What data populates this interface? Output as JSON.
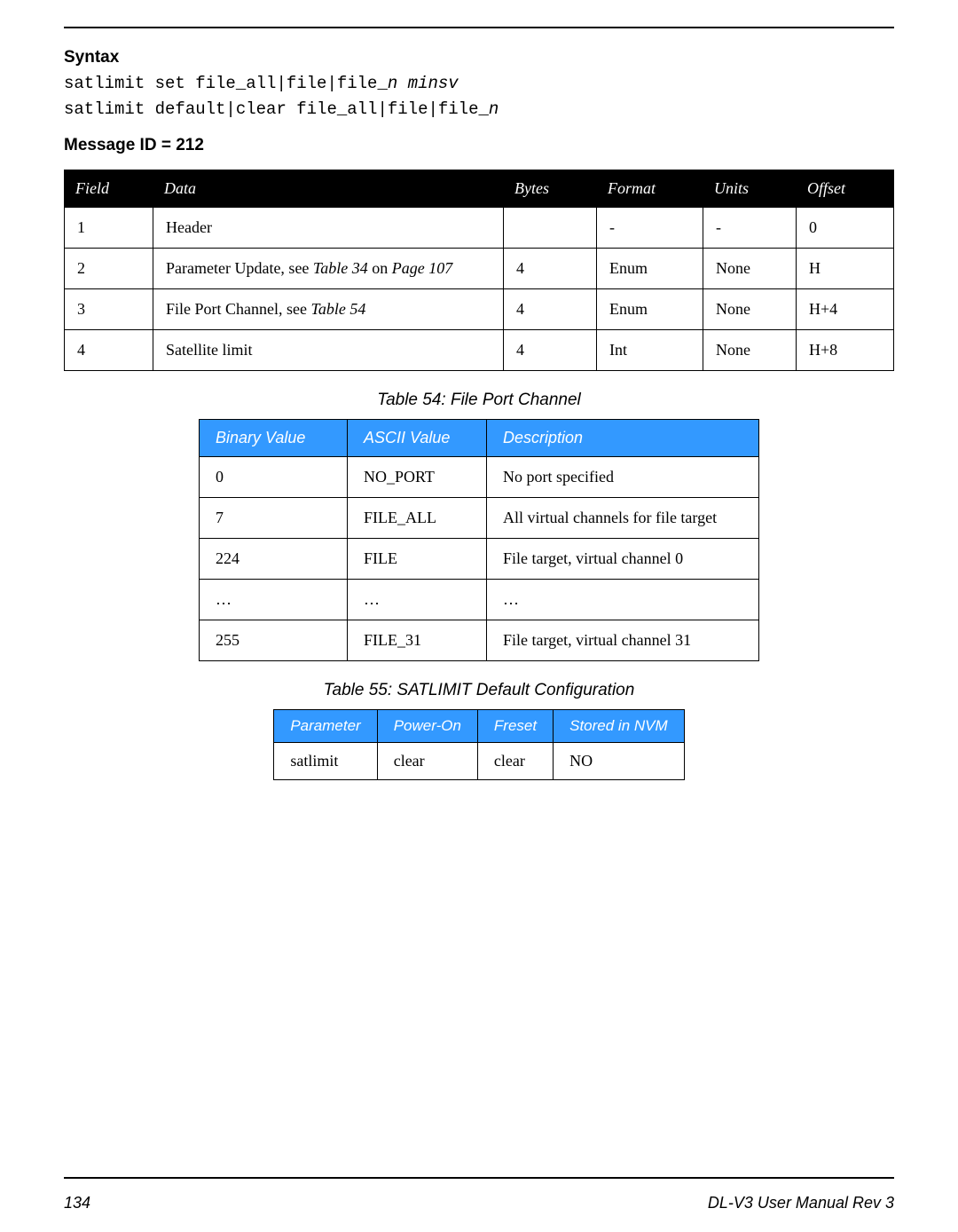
{
  "headings": {
    "syntax": "Syntax",
    "message_id": "Message ID = 212"
  },
  "syntax_lines": {
    "line1_prefix": "satlimit set file_all|file|file_",
    "line1_n": "n",
    "line1_space": " ",
    "line1_minsv": "minsv",
    "line2_prefix": "satlimit default|clear file_all|file|file_",
    "line2_n": "n"
  },
  "table_fields": {
    "headers": {
      "field": "Field",
      "data": "Data",
      "bytes": "Bytes",
      "format": "Format",
      "units": "Units",
      "offset": "Offset"
    },
    "rows": [
      {
        "field": "1",
        "data": "Header",
        "bytes": "",
        "format": "-",
        "units": "-",
        "offset": "0"
      },
      {
        "field": "2",
        "data_prefix": "Parameter Update, see ",
        "data_ref1": "Table 34",
        "data_mid": " on ",
        "data_ref2": "Page 107",
        "bytes": "4",
        "format": "Enum",
        "units": "None",
        "offset": "H"
      },
      {
        "field": "3",
        "data_prefix": "File Port Channel, see ",
        "data_ref1": "Table 54",
        "bytes": "4",
        "format": "Enum",
        "units": "None",
        "offset": "H+4"
      },
      {
        "field": "4",
        "data": "Satellite limit",
        "bytes": "4",
        "format": "Int",
        "units": "None",
        "offset": "H+8"
      }
    ]
  },
  "table54": {
    "caption": "Table 54: File Port Channel",
    "headers": {
      "bin": "Binary Value",
      "ascii": "ASCII Value",
      "desc": "Description"
    },
    "rows": [
      {
        "bin": "0",
        "ascii": "NO_PORT",
        "desc": "No port specified"
      },
      {
        "bin": "7",
        "ascii": "FILE_ALL",
        "desc": "All virtual channels for file target"
      },
      {
        "bin": "224",
        "ascii": "FILE",
        "desc": "File target, virtual channel 0"
      },
      {
        "bin": "…",
        "ascii": "…",
        "desc": "…"
      },
      {
        "bin": "255",
        "ascii": "FILE_31",
        "desc": "File target, virtual channel 31"
      }
    ]
  },
  "table55": {
    "caption": "Table 55: SATLIMIT Default Configuration",
    "headers": {
      "param": "Parameter",
      "poweron": "Power-On",
      "freset": "Freset",
      "nvm": "Stored in NVM"
    },
    "rows": [
      {
        "param": "satlimit",
        "poweron": "clear",
        "freset": "clear",
        "nvm": "NO"
      }
    ]
  },
  "footer": {
    "page": "134",
    "title": "DL-V3 User Manual Rev 3"
  }
}
